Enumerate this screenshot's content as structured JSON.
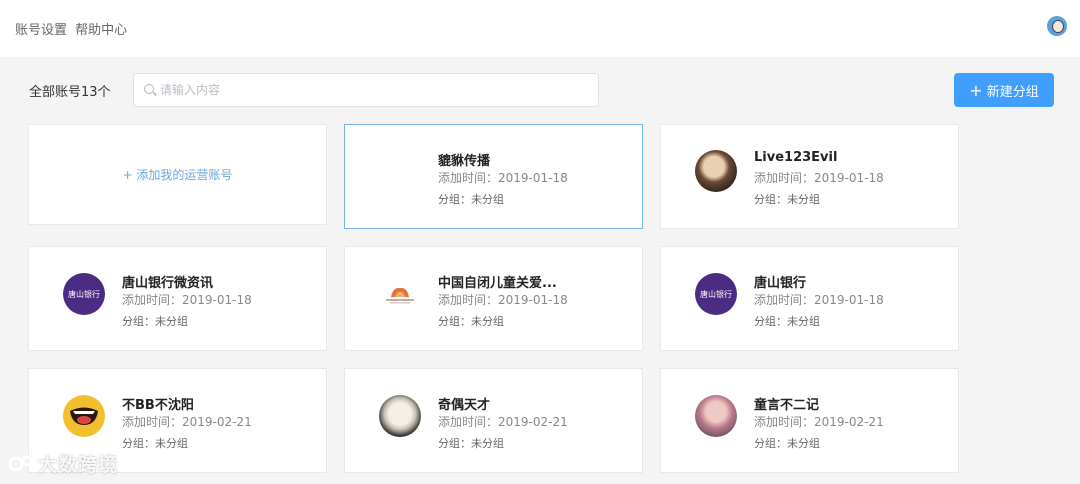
{
  "header": {
    "links": [
      "账号设置",
      "帮助中心"
    ]
  },
  "toolbar": {
    "total_label": "全部账号13个",
    "search_placeholder": "请输入内容",
    "search_value": "",
    "new_group_label": "新建分组"
  },
  "add_card": {
    "label": "+ 添加我的运营账号"
  },
  "accounts": [
    {
      "name": "貔貅传播",
      "time": "添加时间：2019-01-18",
      "group": "分组：未分组",
      "avatar_icon": "none",
      "selected": true
    },
    {
      "name": "Live123Evil",
      "time": "添加时间：2019-01-18",
      "group": "分组：未分组",
      "avatar_icon": "photo-avatar"
    },
    {
      "name": "唐山银行微资讯",
      "time": "添加时间：2019-01-18",
      "group": "分组：未分组",
      "avatar_icon": "bank-logo-avatar",
      "avatar_text": "唐山银行"
    },
    {
      "name": "中国自闭儿童关爱...",
      "time": "添加时间：2019-01-18",
      "group": "分组：未分组",
      "avatar_icon": "charity-logo-avatar"
    },
    {
      "name": "唐山银行",
      "time": "添加时间：2019-01-18",
      "group": "分组：未分组",
      "avatar_icon": "bank-logo-avatar",
      "avatar_text": "唐山银行"
    },
    {
      "name": "不BB不沈阳",
      "time": "添加时间：2019-02-21",
      "group": "分组：未分组",
      "avatar_icon": "cartoon-mouth-avatar"
    },
    {
      "name": "奇偶天才",
      "time": "添加时间：2019-02-21",
      "group": "分组：未分组",
      "avatar_icon": "portrait-avatar"
    },
    {
      "name": "童言不二记",
      "time": "添加时间：2019-02-21",
      "group": "分组：未分组",
      "avatar_icon": "photo-avatar"
    }
  ],
  "watermark": {
    "text": "大数跨境"
  },
  "colors": {
    "primary": "#409eff",
    "link": "#69a6d9",
    "background": "#f4f4f5",
    "bank": "#4a2c83",
    "selected_border": "#79b4e8"
  }
}
